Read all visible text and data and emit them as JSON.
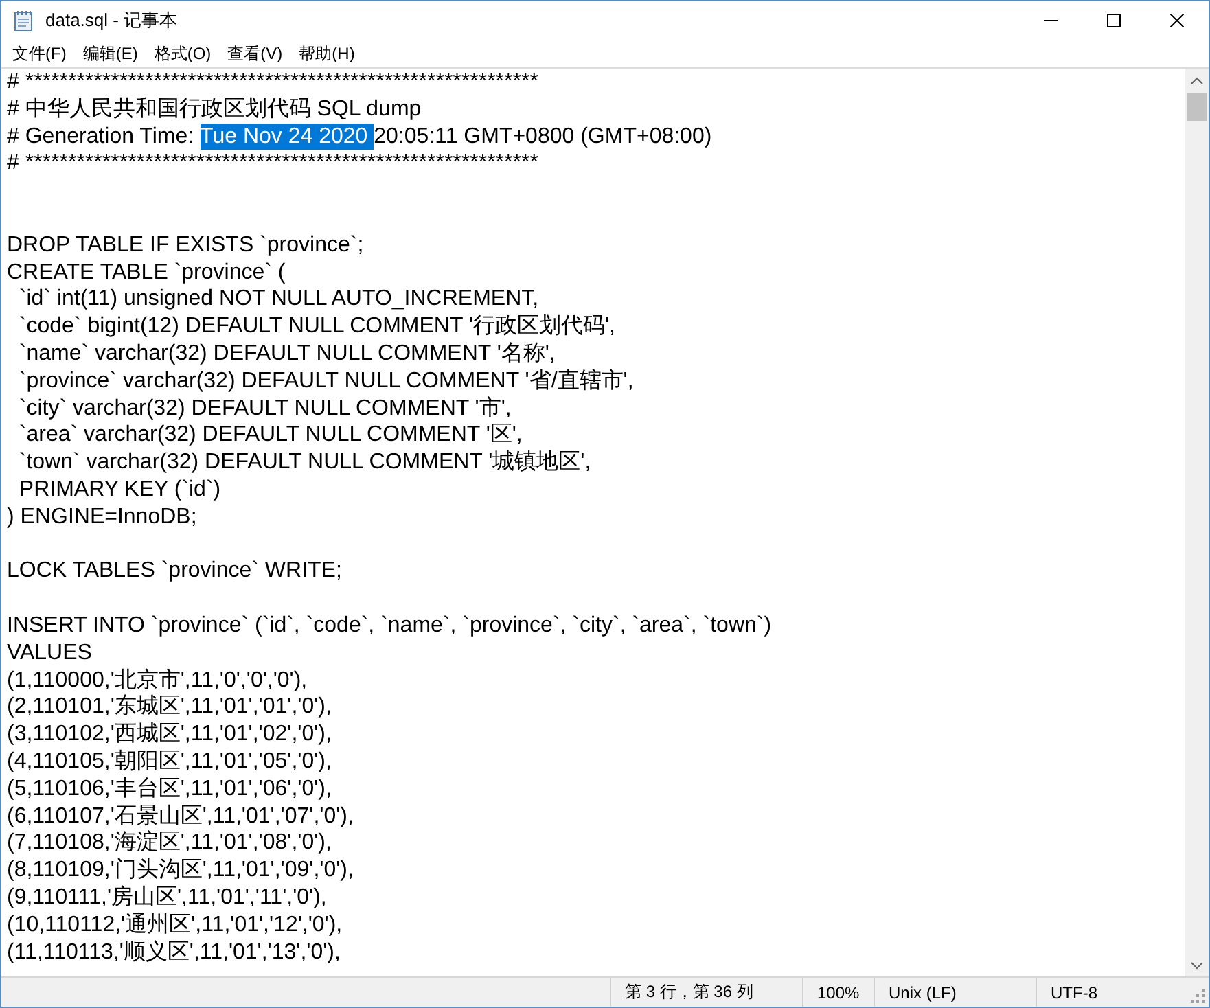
{
  "window": {
    "title": "data.sql - 记事本"
  },
  "menu": [
    "文件(F)",
    "编辑(E)",
    "格式(O)",
    "查看(V)",
    "帮助(H)"
  ],
  "editor": {
    "lines": [
      {
        "kind": "text",
        "segments": [
          {
            "text": "# ************************************************************",
            "selected": false
          }
        ]
      },
      {
        "kind": "text",
        "segments": [
          {
            "text": "# 中华人民共和国行政区划代码 SQL dump",
            "selected": false
          }
        ]
      },
      {
        "kind": "text",
        "segments": [
          {
            "text": "# Generation Time: ",
            "selected": false
          },
          {
            "text": "Tue Nov 24 2020 ",
            "selected": true
          },
          {
            "text": "20:05:11 GMT+0800 (GMT+08:00)",
            "selected": false
          }
        ]
      },
      {
        "kind": "text",
        "segments": [
          {
            "text": "# ************************************************************",
            "selected": false
          }
        ]
      },
      {
        "kind": "blank"
      },
      {
        "kind": "blank"
      },
      {
        "kind": "text",
        "segments": [
          {
            "text": "DROP TABLE IF EXISTS `province`;",
            "selected": false
          }
        ]
      },
      {
        "kind": "text",
        "segments": [
          {
            "text": "CREATE TABLE `province` (",
            "selected": false
          }
        ]
      },
      {
        "kind": "text",
        "segments": [
          {
            "text": "  `id` int(11) unsigned NOT NULL AUTO_INCREMENT,",
            "selected": false
          }
        ]
      },
      {
        "kind": "text",
        "segments": [
          {
            "text": "  `code` bigint(12) DEFAULT NULL COMMENT '行政区划代码',",
            "selected": false
          }
        ]
      },
      {
        "kind": "text",
        "segments": [
          {
            "text": "  `name` varchar(32) DEFAULT NULL COMMENT '名称',",
            "selected": false
          }
        ]
      },
      {
        "kind": "text",
        "segments": [
          {
            "text": "  `province` varchar(32) DEFAULT NULL COMMENT '省/直辖市',",
            "selected": false
          }
        ]
      },
      {
        "kind": "text",
        "segments": [
          {
            "text": "  `city` varchar(32) DEFAULT NULL COMMENT '市',",
            "selected": false
          }
        ]
      },
      {
        "kind": "text",
        "segments": [
          {
            "text": "  `area` varchar(32) DEFAULT NULL COMMENT '区',",
            "selected": false
          }
        ]
      },
      {
        "kind": "text",
        "segments": [
          {
            "text": "  `town` varchar(32) DEFAULT NULL COMMENT '城镇地区',",
            "selected": false
          }
        ]
      },
      {
        "kind": "text",
        "segments": [
          {
            "text": "  PRIMARY KEY (`id`)",
            "selected": false
          }
        ]
      },
      {
        "kind": "text",
        "segments": [
          {
            "text": ") ENGINE=InnoDB;",
            "selected": false
          }
        ]
      },
      {
        "kind": "blank"
      },
      {
        "kind": "text",
        "segments": [
          {
            "text": "LOCK TABLES `province` WRITE;",
            "selected": false
          }
        ]
      },
      {
        "kind": "blank"
      },
      {
        "kind": "text",
        "segments": [
          {
            "text": "INSERT INTO `province` (`id`, `code`, `name`, `province`, `city`, `area`, `town`)",
            "selected": false
          }
        ]
      },
      {
        "kind": "text",
        "segments": [
          {
            "text": "VALUES",
            "selected": false
          }
        ]
      },
      {
        "kind": "text",
        "segments": [
          {
            "text": "(1,110000,'北京市',11,'0','0','0'),",
            "selected": false
          }
        ]
      },
      {
        "kind": "text",
        "segments": [
          {
            "text": "(2,110101,'东城区',11,'01','01','0'),",
            "selected": false
          }
        ]
      },
      {
        "kind": "text",
        "segments": [
          {
            "text": "(3,110102,'西城区',11,'01','02','0'),",
            "selected": false
          }
        ]
      },
      {
        "kind": "text",
        "segments": [
          {
            "text": "(4,110105,'朝阳区',11,'01','05','0'),",
            "selected": false
          }
        ]
      },
      {
        "kind": "text",
        "segments": [
          {
            "text": "(5,110106,'丰台区',11,'01','06','0'),",
            "selected": false
          }
        ]
      },
      {
        "kind": "text",
        "segments": [
          {
            "text": "(6,110107,'石景山区',11,'01','07','0'),",
            "selected": false
          }
        ]
      },
      {
        "kind": "text",
        "segments": [
          {
            "text": "(7,110108,'海淀区',11,'01','08','0'),",
            "selected": false
          }
        ]
      },
      {
        "kind": "text",
        "segments": [
          {
            "text": "(8,110109,'门头沟区',11,'01','09','0'),",
            "selected": false
          }
        ]
      },
      {
        "kind": "text",
        "segments": [
          {
            "text": "(9,110111,'房山区',11,'01','11','0'),",
            "selected": false
          }
        ]
      },
      {
        "kind": "text",
        "segments": [
          {
            "text": "(10,110112,'通州区',11,'01','12','0'),",
            "selected": false
          }
        ]
      },
      {
        "kind": "text",
        "segments": [
          {
            "text": "(11,110113,'顺义区',11,'01','13','0'),",
            "selected": false
          }
        ]
      }
    ]
  },
  "status_bar": [
    "第 3 行，第 36 列",
    "100%",
    "Unix (LF)",
    "UTF-8"
  ]
}
